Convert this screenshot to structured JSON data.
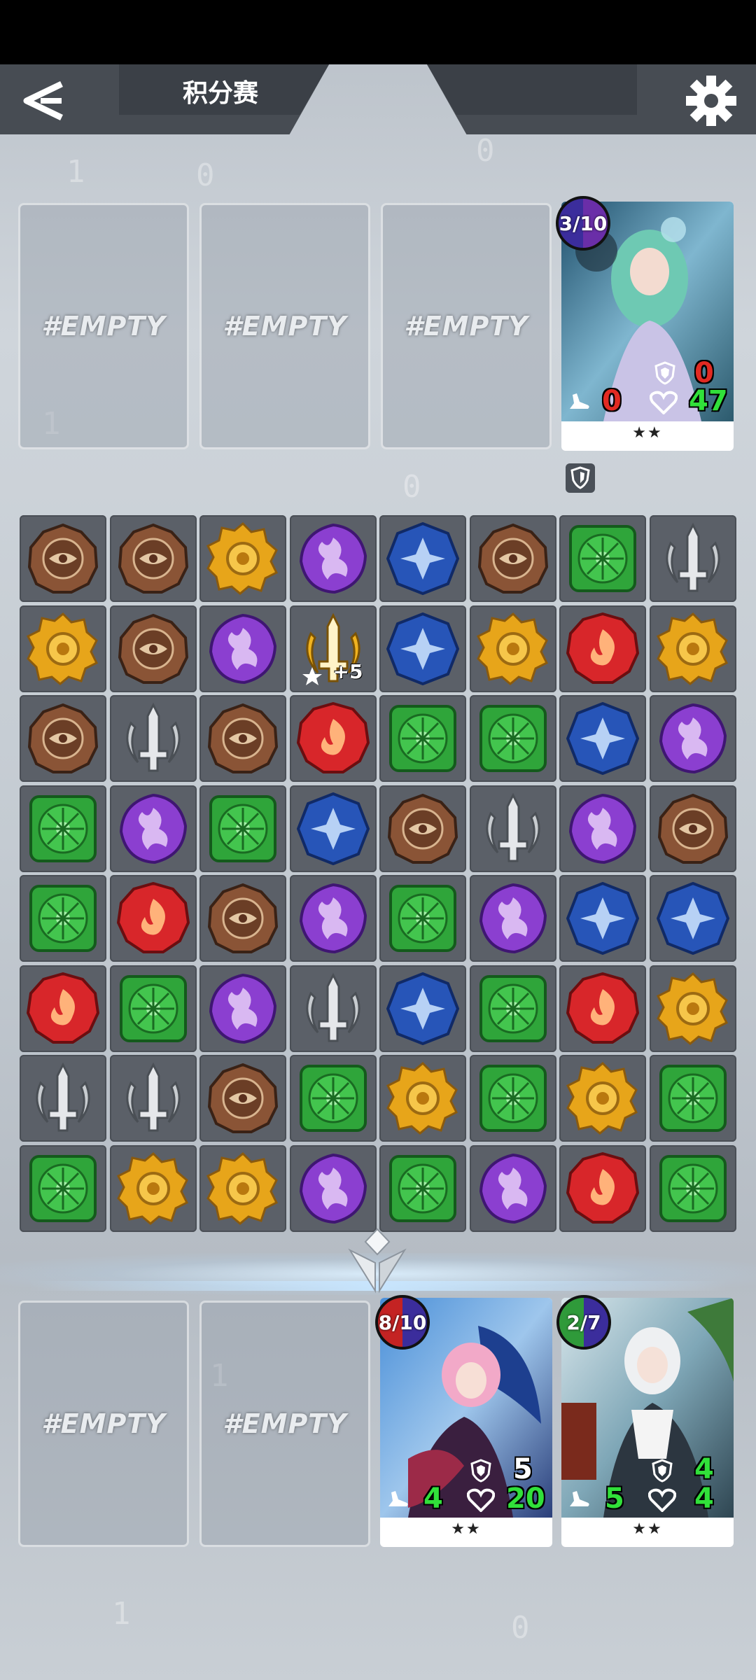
{
  "header": {
    "title": "积分赛"
  },
  "icons": {
    "back": "back-arrow-icon",
    "settings": "gear-icon"
  },
  "enemy_slots": [
    "#EMPTY",
    "#EMPTY",
    "#EMPTY"
  ],
  "enemy_card": {
    "count": "3/10",
    "shield": "0",
    "move": "0",
    "hp": "47",
    "stars": "★★"
  },
  "player_slots": [
    "#EMPTY",
    "#EMPTY"
  ],
  "player_cards": [
    {
      "count": "8/10",
      "shield": "5",
      "move": "4",
      "hp": "20",
      "stars": "★★"
    },
    {
      "count": "2/7",
      "shield": "4",
      "move": "5",
      "hp": "4",
      "stars": "★★"
    }
  ],
  "board": {
    "bonus_label": "+5",
    "rows": [
      [
        "brown",
        "brown",
        "yellow",
        "purple",
        "blue",
        "brown",
        "green",
        "silver"
      ],
      [
        "yellow",
        "brown",
        "purple",
        "gold-sword",
        "blue",
        "yellow",
        "red",
        "yellow"
      ],
      [
        "brown",
        "silver",
        "brown",
        "red",
        "green",
        "green",
        "blue",
        "purple"
      ],
      [
        "green",
        "purple",
        "green",
        "blue",
        "brown",
        "silver",
        "purple",
        "brown"
      ],
      [
        "green",
        "red",
        "brown",
        "purple",
        "green",
        "purple",
        "blue",
        "blue"
      ],
      [
        "red",
        "green",
        "purple",
        "silver",
        "blue",
        "green",
        "red",
        "yellow"
      ],
      [
        "silver",
        "silver",
        "brown",
        "green",
        "yellow",
        "green",
        "yellow",
        "green"
      ],
      [
        "green",
        "yellow",
        "yellow",
        "purple",
        "green",
        "purple",
        "red",
        "green"
      ]
    ]
  },
  "colors": {
    "brown": "#8a5436",
    "yellow": "#e7a51a",
    "purple": "#8b3fd0",
    "blue": "#2755b8",
    "green": "#2fa53a",
    "red": "#d8262a",
    "silver": "#a9adb3",
    "gold-sword": "#f1b320"
  }
}
